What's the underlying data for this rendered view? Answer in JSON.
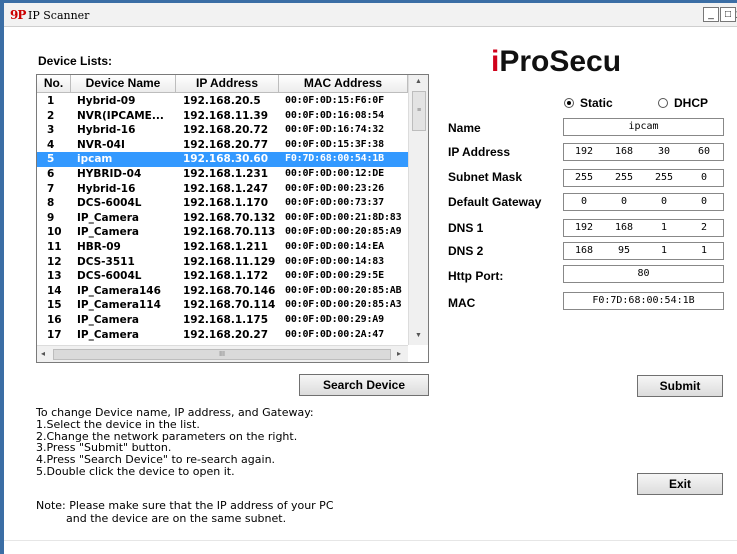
{
  "window": {
    "title": "IP Scanner",
    "app_icon_text": "9P",
    "minimize_label": "_",
    "maximize_label": "□",
    "close_label": "x"
  },
  "device_list": {
    "label": "Device Lists:",
    "columns": [
      "No.",
      "Device Name",
      "IP Address",
      "MAC Address"
    ],
    "selected_index": 4,
    "rows": [
      {
        "no": "1",
        "name": "Hybrid-09",
        "ip": "192.168.20.5",
        "mac": "00:0F:0D:15:F6:0F"
      },
      {
        "no": "2",
        "name": "NVR(IPCAME...",
        "ip": "192.168.11.39",
        "mac": "00:0F:0D:16:08:54"
      },
      {
        "no": "3",
        "name": "Hybrid-16",
        "ip": "192.168.20.72",
        "mac": "00:0F:0D:16:74:32"
      },
      {
        "no": "4",
        "name": "NVR-04I",
        "ip": "192.168.20.77",
        "mac": "00:0F:0D:15:3F:38"
      },
      {
        "no": "5",
        "name": "ipcam",
        "ip": "192.168.30.60",
        "mac": "F0:7D:68:00:54:1B"
      },
      {
        "no": "6",
        "name": "HYBRID-04",
        "ip": "192.168.1.231",
        "mac": "00:0F:0D:00:12:DE"
      },
      {
        "no": "7",
        "name": "Hybrid-16",
        "ip": "192.168.1.247",
        "mac": "00:0F:0D:00:23:26"
      },
      {
        "no": "8",
        "name": "DCS-6004L",
        "ip": "192.168.1.170",
        "mac": "00:0F:0D:00:73:37"
      },
      {
        "no": "9",
        "name": "IP_Camera",
        "ip": "192.168.70.132",
        "mac": "00:0F:0D:00:21:8D:83"
      },
      {
        "no": "10",
        "name": "IP_Camera",
        "ip": "192.168.70.113",
        "mac": "00:0F:0D:00:20:85:A9"
      },
      {
        "no": "11",
        "name": "HBR-09",
        "ip": "192.168.1.211",
        "mac": "00:0F:0D:00:14:EA"
      },
      {
        "no": "12",
        "name": "DCS-3511",
        "ip": "192.168.11.129",
        "mac": "00:0F:0D:00:14:83"
      },
      {
        "no": "13",
        "name": "DCS-6004L",
        "ip": "192.168.1.172",
        "mac": "00:0F:0D:00:29:5E"
      },
      {
        "no": "14",
        "name": "IP_Camera146",
        "ip": "192.168.70.146",
        "mac": "00:0F:0D:00:20:85:AB"
      },
      {
        "no": "15",
        "name": "IP_Camera114",
        "ip": "192.168.70.114",
        "mac": "00:0F:0D:00:20:85:A3"
      },
      {
        "no": "16",
        "name": "IP_Camera",
        "ip": "192.168.1.175",
        "mac": "00:0F:0D:00:29:A9"
      },
      {
        "no": "17",
        "name": "IP_Camera",
        "ip": "192.168.20.27",
        "mac": "00:0F:0D:00:2A:47"
      }
    ],
    "hscroll_thumb": "III",
    "vscroll_thumb": "≡"
  },
  "buttons": {
    "search": "Search Device",
    "submit": "Submit",
    "exit": "Exit"
  },
  "instructions": {
    "lines": [
      "To change Device name, IP address, and Gateway:",
      "1.Select the device in the list.",
      "2.Change the network parameters on the right.",
      "3.Press \"Submit\" button.",
      "4.Press \"Search Device\" to re-search again.",
      "5.Double click the device to open it."
    ],
    "note_line1": "Note: Please make sure that the IP address of your PC",
    "note_line2": "and the device are on the same subnet."
  },
  "brand": {
    "first_letter": "i",
    "rest": "ProSecu",
    "accent_color": "#d0021b"
  },
  "network": {
    "mode": "Static",
    "static_label": "Static",
    "dhcp_label": "DHCP",
    "name_label": "Name",
    "name_value": "ipcam",
    "ip_label": "IP Address",
    "ip": [
      "192",
      "168",
      "30",
      "60"
    ],
    "subnet_label": "Subnet Mask",
    "subnet": [
      "255",
      "255",
      "255",
      "0"
    ],
    "gateway_label": "Default Gateway",
    "gateway": [
      "0",
      "0",
      "0",
      "0"
    ],
    "dns1_label": "DNS 1",
    "dns1": [
      "192",
      "168",
      "1",
      "2"
    ],
    "dns2_label": "DNS 2",
    "dns2": [
      "168",
      "95",
      "1",
      "1"
    ],
    "http_label": "Http Port:",
    "http_port": "80",
    "mac_label": "MAC",
    "mac_value": "F0:7D:68:00:54:1B"
  },
  "colors": {
    "selection": "#3399ff",
    "window_border": "#3b6ea5"
  }
}
